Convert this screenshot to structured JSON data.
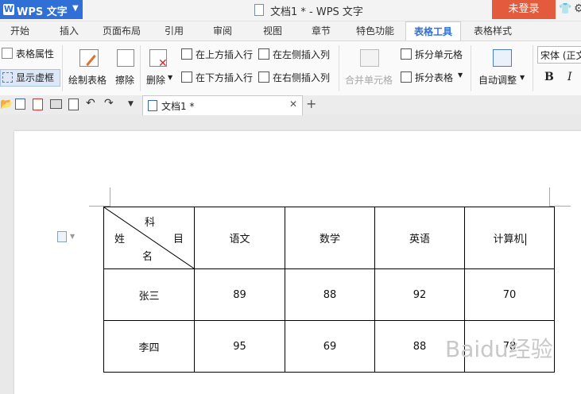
{
  "titlebar": {
    "app_name": "WPS 文字",
    "doc_title": "文档1 * - WPS 文字",
    "login": "未登录"
  },
  "tabs": [
    {
      "label": "开始"
    },
    {
      "label": "插入"
    },
    {
      "label": "页面布局"
    },
    {
      "label": "引用"
    },
    {
      "label": "审阅"
    },
    {
      "label": "视图"
    },
    {
      "label": "章节"
    },
    {
      "label": "特色功能"
    },
    {
      "label": "表格工具"
    },
    {
      "label": "表格样式"
    }
  ],
  "ribbon": {
    "table_props": "表格属性",
    "show_gridlines": "显示虚框",
    "draw_table": "绘制表格",
    "eraser": "擦除",
    "delete": "删除",
    "insert_above": "在上方插入行",
    "insert_below": "在下方插入行",
    "insert_left": "在左侧插入列",
    "insert_right": "在右侧插入列",
    "merge_cells": "合并单元格",
    "split_cells": "拆分单元格",
    "split_table": "拆分表格",
    "auto_adjust": "自动调整",
    "font_name": "宋体 (正文",
    "bold": "B",
    "italic": "I"
  },
  "doc_tab": {
    "label": "文档1 *"
  },
  "table": {
    "header_diag": {
      "top": "科",
      "middle_left": "姓",
      "middle_right": "目",
      "bottom": "名"
    },
    "columns": [
      "语文",
      "数学",
      "英语",
      "计算机"
    ],
    "rows": [
      {
        "name": "张三",
        "scores": [
          "89",
          "88",
          "92",
          "70"
        ]
      },
      {
        "name": "李四",
        "scores": [
          "95",
          "69",
          "88",
          "78"
        ]
      }
    ]
  },
  "watermark": "Baidu经验"
}
